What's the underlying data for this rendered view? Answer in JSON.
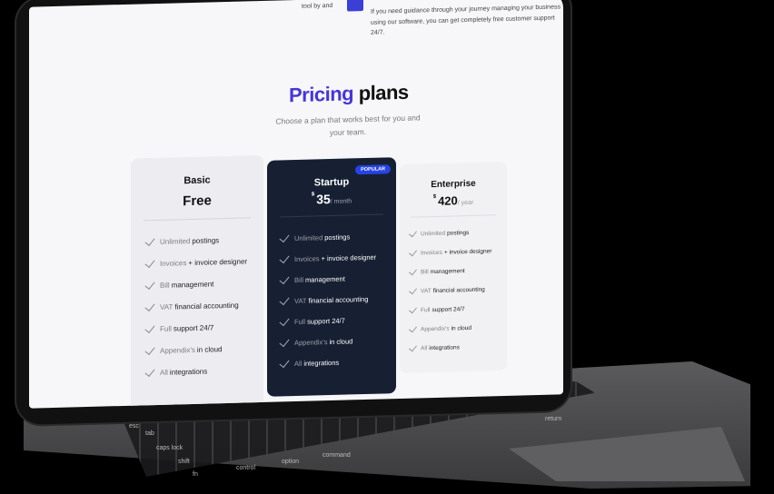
{
  "top": {
    "left_fragment": "tool by and",
    "right_line1": "If you need guidance through your journey managing your business",
    "right_line2": "using our software, you can get completely free customer support 24/7."
  },
  "pricing": {
    "title_accent": "Pricing",
    "title_rest": "plans",
    "subtitle": "Choose a plan that works best for you and your team."
  },
  "plans": [
    {
      "name": "Basic",
      "price_text": "Free",
      "features": [
        {
          "hl": "Unlimited",
          "rest": "postings"
        },
        {
          "hl": "Invoices",
          "rest": "+ invoice designer"
        },
        {
          "hl": "Bill",
          "rest": "management"
        },
        {
          "hl": "VAT",
          "rest": "financial accounting"
        },
        {
          "hl": "Full",
          "rest": "support 24/7"
        },
        {
          "hl": "Appendix's",
          "rest": "in cloud"
        },
        {
          "hl": "All",
          "rest": "integrations"
        }
      ]
    },
    {
      "name": "Startup",
      "badge": "POPULAR",
      "currency": "$",
      "amount": "35",
      "unit": "/ month",
      "features": [
        {
          "hl": "Unlimited",
          "rest": "postings"
        },
        {
          "hl": "Invoices",
          "rest": "+ invoice designer"
        },
        {
          "hl": "Bill",
          "rest": "management"
        },
        {
          "hl": "VAT",
          "rest": "financial accounting"
        },
        {
          "hl": "Full",
          "rest": "support 24/7"
        },
        {
          "hl": "Appendix's",
          "rest": "in cloud"
        },
        {
          "hl": "All",
          "rest": "integrations"
        }
      ]
    },
    {
      "name": "Enterprise",
      "currency": "$",
      "amount": "420",
      "unit": "/ year",
      "features": [
        {
          "hl": "Unlimited",
          "rest": "postings"
        },
        {
          "hl": "Invoices",
          "rest": "+ invoice designer"
        },
        {
          "hl": "Bill",
          "rest": "management"
        },
        {
          "hl": "VAT",
          "rest": "financial accounting"
        },
        {
          "hl": "Full",
          "rest": "support 24/7"
        },
        {
          "hl": "Appendix's",
          "rest": "in cloud"
        },
        {
          "hl": "All",
          "rest": "integrations"
        }
      ]
    }
  ],
  "keyboard": {
    "keys": [
      "esc",
      "tab",
      "caps lock",
      "shift",
      "fn",
      "control",
      "option",
      "command",
      "delete",
      "return"
    ]
  },
  "colors": {
    "accent": "#4636d8",
    "popular_card": "#172033",
    "badge": "#2544e6"
  }
}
